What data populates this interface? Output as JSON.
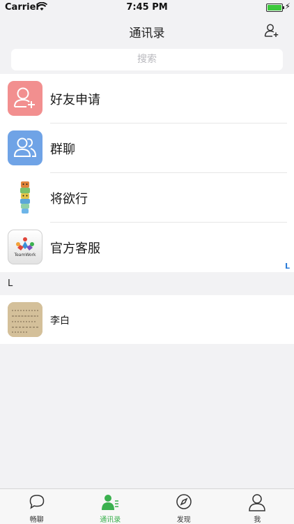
{
  "status_bar": {
    "carrier": "Carrier",
    "time": "7:45 PM"
  },
  "nav": {
    "title": "通讯录"
  },
  "search": {
    "placeholder": "搜索"
  },
  "contacts_top": [
    {
      "label": "好友申请",
      "icon": "add-friend-icon"
    },
    {
      "label": "群聊",
      "icon": "group-icon"
    },
    {
      "label": "将欲行",
      "icon": "totem-avatar"
    },
    {
      "label": "官方客服",
      "icon": "teamwork-logo"
    }
  ],
  "teamwork_logo_text": "TeamWork",
  "index_letter": "L",
  "section": {
    "letter": "L"
  },
  "contacts_l": [
    {
      "label": "李白",
      "icon": "calligraphy-avatar"
    }
  ],
  "tabs": [
    {
      "label": "畅聊",
      "icon": "chat-bubble-icon"
    },
    {
      "label": "通讯录",
      "icon": "contacts-icon",
      "active": true
    },
    {
      "label": "发现",
      "icon": "compass-icon"
    },
    {
      "label": "我",
      "icon": "person-icon"
    }
  ],
  "colors": {
    "accent": "#3bb14f",
    "friend_request": "#f28f8f",
    "group_chat": "#6fa3e6"
  }
}
